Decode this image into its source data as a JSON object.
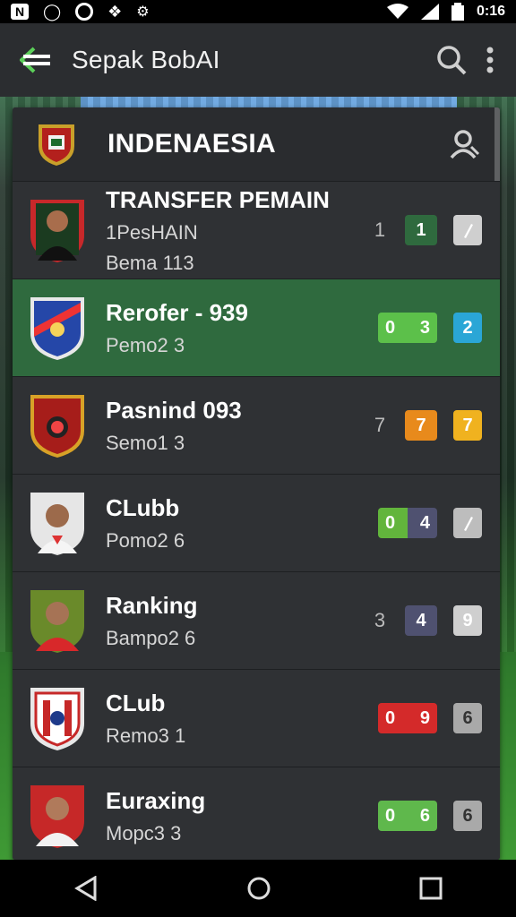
{
  "status_bar": {
    "icons": [
      "notification-n-icon",
      "voicemail-icon",
      "sync-icon",
      "shield-icon",
      "game-icon"
    ],
    "time": "0:16",
    "right_icons": [
      "wifi-icon",
      "signal-icon",
      "battery-icon"
    ]
  },
  "app_bar": {
    "title": "Sepak BobAI",
    "icons": [
      "back-arrow-icon",
      "search-icon",
      "more-vert-icon"
    ]
  },
  "panel": {
    "country": "INDENAESIA",
    "header_icons": [
      "crest-icon",
      "account-icon"
    ]
  },
  "rows": [
    {
      "name": "TRANSFER PEMAIN",
      "line1": "1PesHAIN",
      "line2": "Bema 113",
      "num": "1",
      "chip": "1",
      "chip_color": "#2f6a3e",
      "sq": "",
      "sq_color": "#cfcfcf"
    },
    {
      "name": "Rerofer - 939",
      "line1": "Pemo2 3",
      "num": "",
      "chip_left": "0",
      "chip": "3",
      "chip_color": "#5cc04a",
      "sq": "2",
      "sq_color": "#2aa6d6"
    },
    {
      "name": "Pasnind 093",
      "line1": "Semo1 3",
      "num": "7",
      "chip": "7",
      "chip_color": "#e88a1c",
      "sq": "7",
      "sq_color": "#f0b21f"
    },
    {
      "name": "CLubb",
      "line1": "Pomo2 6",
      "num": "",
      "chip_left": "0",
      "chip": "4",
      "chip_color": "#62b53c",
      "sq": "",
      "sq_color": "#bdbdbd"
    },
    {
      "name": "Ranking",
      "line1": "Bampo2 6",
      "num": "3",
      "chip": "4",
      "chip_color": "#4f5170",
      "sq": "9",
      "sq_color": "#cfcfcf"
    },
    {
      "name": "CLub",
      "line1": "Remo3 1",
      "num": "",
      "chip_left": "0",
      "chip": "9",
      "chip_color": "#d42a2a",
      "sq": "6",
      "sq_color": "#a9a9a9"
    },
    {
      "name": "Euraxing",
      "line1": "Mopc3 3",
      "num": "",
      "chip_left": "0",
      "chip": "6",
      "chip_color": "#5fb84c",
      "sq": "6",
      "sq_color": "#a9a9a9"
    }
  ],
  "nav_bar": {
    "icons": [
      "nav-back-icon",
      "nav-home-icon",
      "nav-recents-icon"
    ]
  }
}
